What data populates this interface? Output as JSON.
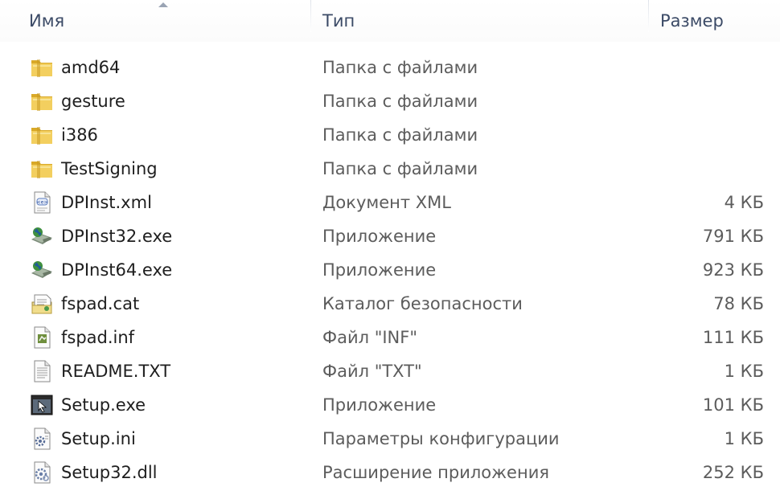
{
  "columns": {
    "name": "Имя",
    "type": "Тип",
    "size": "Размер"
  },
  "files": [
    {
      "name": "amd64",
      "type": "Папка с файлами",
      "size": "",
      "icon": "folder-icon"
    },
    {
      "name": "gesture",
      "type": "Папка с файлами",
      "size": "",
      "icon": "folder-icon"
    },
    {
      "name": "i386",
      "type": "Папка с файлами",
      "size": "",
      "icon": "folder-icon"
    },
    {
      "name": "TestSigning",
      "type": "Папка с файлами",
      "size": "",
      "icon": "folder-icon"
    },
    {
      "name": "DPInst.xml",
      "type": "Документ XML",
      "size": "4 КБ",
      "icon": "xml-document-icon"
    },
    {
      "name": "DPInst32.exe",
      "type": "Приложение",
      "size": "791 КБ",
      "icon": "installer-icon"
    },
    {
      "name": "DPInst64.exe",
      "type": "Приложение",
      "size": "923 КБ",
      "icon": "installer-icon"
    },
    {
      "name": "fspad.cat",
      "type": "Каталог безопасности",
      "size": "78 КБ",
      "icon": "security-catalog-icon"
    },
    {
      "name": "fspad.inf",
      "type": "Файл \"INF\"",
      "size": "111 КБ",
      "icon": "inf-file-icon"
    },
    {
      "name": "README.TXT",
      "type": "Файл \"TXT\"",
      "size": "1 КБ",
      "icon": "text-file-icon"
    },
    {
      "name": "Setup.exe",
      "type": "Приложение",
      "size": "101 КБ",
      "icon": "setup-app-icon"
    },
    {
      "name": "Setup.ini",
      "type": "Параметры конфигурации",
      "size": "1 КБ",
      "icon": "config-file-icon"
    },
    {
      "name": "Setup32.dll",
      "type": "Расширение приложения",
      "size": "252 КБ",
      "icon": "dll-file-icon"
    }
  ],
  "colors": {
    "header_text": "#3b4a66",
    "name_text": "#1e1e1e",
    "detail_text": "#5c5c5c",
    "folder": "#e8c14e"
  }
}
